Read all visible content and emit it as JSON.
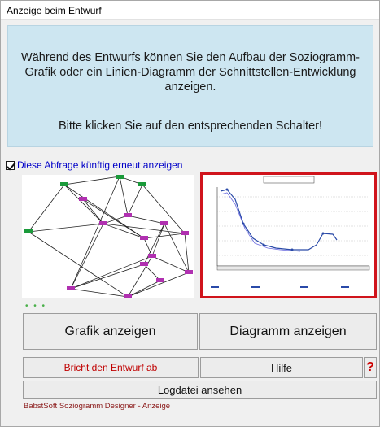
{
  "window": {
    "title": "Anzeige beim Entwurf"
  },
  "info": {
    "message": "Während des Entwurfs können Sie den Aufbau der Soziogramm-Grafik oder ein Linien-Diagramm der Schnittstellen-Entwicklung anzeigen.",
    "instruction": "Bitte klicken Sie auf den entsprechenden Schalter!"
  },
  "checkbox": {
    "label": "Diese Abfrage künftig erneut anzeigen",
    "checked": true
  },
  "buttons": {
    "grafik": "Grafik anzeigen",
    "diagramm": "Diagramm anzeigen",
    "abbruch": "Bricht den Entwurf ab",
    "hilfe": "Hilfe",
    "help_symbol": "?",
    "logdatei": "Logdatei ansehen"
  },
  "status_dots": "• • •",
  "footer": "BabstSoft Soziogramm Designer - Anzeige",
  "colors": {
    "info_bg": "#cde6f1",
    "highlight_border": "#d0141c",
    "checkbox_label": "#0000c8"
  }
}
